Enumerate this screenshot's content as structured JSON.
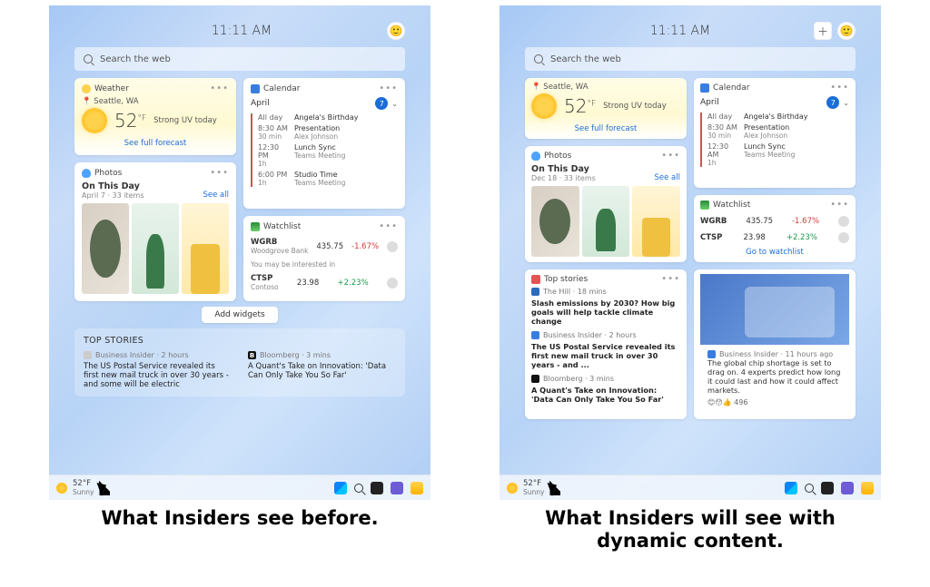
{
  "time": "11:11 AM",
  "search_placeholder": "Search the web",
  "weather": {
    "title": "Weather",
    "location": "Seattle, WA",
    "temp": "52",
    "unit": "°F",
    "condition": "Strong UV today",
    "link": "See full forecast"
  },
  "calendar": {
    "title": "Calendar",
    "month": "April",
    "day": "7",
    "events_before": [
      {
        "when": "All day",
        "sub": "",
        "title": "Angela's Birthday",
        "sub2": ""
      },
      {
        "when": "8:30 AM",
        "sub": "30 min",
        "title": "Presentation",
        "sub2": "Alex Johnson"
      },
      {
        "when": "12:30 PM",
        "sub": "1h",
        "title": "Lunch Sync",
        "sub2": "Teams Meeting"
      },
      {
        "when": "6:00 PM",
        "sub": "1h",
        "title": "Studio Time",
        "sub2": "Teams Meeting"
      }
    ],
    "events_after": [
      {
        "when": "All day",
        "sub": "",
        "title": "Angela's Birthday",
        "sub2": ""
      },
      {
        "when": "8:30 AM",
        "sub": "30 min",
        "title": "Presentation",
        "sub2": "Alex Johnson"
      },
      {
        "when": "12:30 AM",
        "sub": "1h",
        "title": "Lunch Sync",
        "sub2": "Teams Meeting"
      }
    ]
  },
  "photos": {
    "title": "Photos",
    "heading": "On This Day",
    "sub_before": "April 7 · 33 items",
    "sub_after": "Dec 18 · 33 items",
    "see_all": "See all"
  },
  "watchlist": {
    "title": "Watchlist",
    "rows": [
      {
        "sym": "WGRB",
        "name": "Woodgrove Bank",
        "price": "435.75",
        "chg": "-1.67%",
        "dir": "neg"
      },
      {
        "sym": "CTSP",
        "name": "Contoso",
        "price": "23.98",
        "chg": "+2.23%",
        "dir": "pos"
      }
    ],
    "interest_label": "You may be interested in",
    "go": "Go to watchlist"
  },
  "add_widgets": "Add widgets",
  "top_stories": {
    "heading": "TOP STORIES",
    "card_title": "Top stories",
    "left": {
      "src": "Business Insider · 2 hours",
      "text": "The US Postal Service revealed its first new mail truck in over 30 years - and some will be electric"
    },
    "right": {
      "src": "Bloomberg · 3 mins",
      "text": "A Quant's Take on Innovation: 'Data Can Only Take You So Far'"
    },
    "news_after": [
      {
        "src": "The Hill · 18 mins",
        "text": "Slash emissions by 2030? How big goals will help tackle climate change",
        "ico": "hill"
      },
      {
        "src": "Business Insider · 2 hours",
        "text": "The US Postal Service revealed its first new mail truck in over 30 years - and ...",
        "ico": "bi"
      },
      {
        "src": "Bloomberg · 3 mins",
        "text": "A Quant's Take on Innovation: 'Data Can Only Take You So Far'",
        "ico": "b"
      }
    ],
    "image_story": {
      "src": "Business Insider · 11 hours ago",
      "text": "The global chip shortage is set to drag on. 4 experts predict how long it could last and how it could affect markets.",
      "reacts": "😊😯👍 496"
    }
  },
  "taskbar": {
    "temp": "52°F",
    "cond": "Sunny"
  },
  "captions": {
    "before": "What Insiders see before.",
    "after": "What Insiders will see with dynamic content."
  }
}
